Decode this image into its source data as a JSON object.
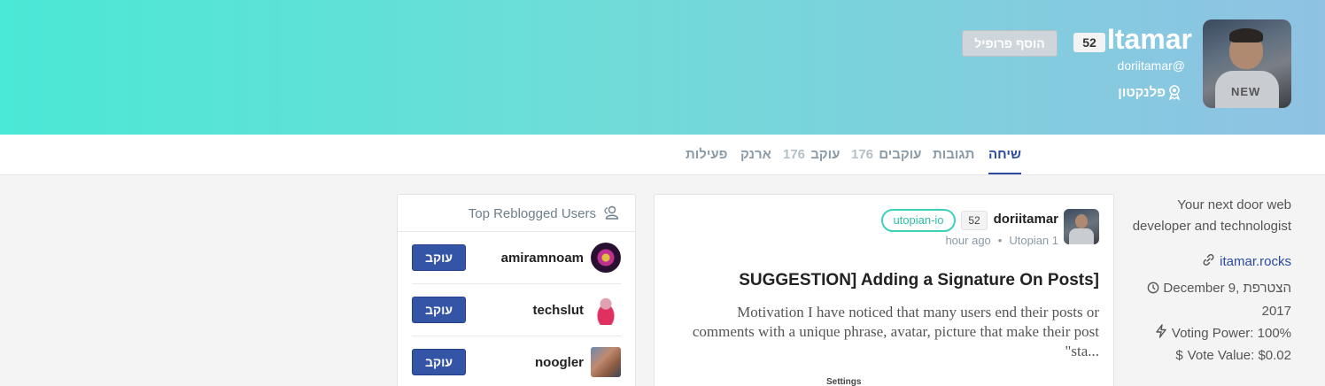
{
  "profile": {
    "name": "Itamar",
    "reputation": "52",
    "handle": "doriitamar@",
    "rank": "פלנקטון",
    "add_profile_label": "הוסף פרופיל"
  },
  "tabs": {
    "blog": "שיחה",
    "comments": "תגובות",
    "followers_label": "עוקבים",
    "followers_count": "176",
    "following_label": "עוקב",
    "following_count": "176",
    "wallet": "ארנק",
    "activity": "פעילות"
  },
  "sidebar": {
    "bio": "Your next door web developer and technologist",
    "website": "itamar.rocks",
    "joined": "December 9, הצטרפת 2017",
    "voting_power": "Voting Power: 100%",
    "vote_value": "Vote Value: $0.02"
  },
  "post": {
    "author": "doriitamar",
    "reputation": "52",
    "tag": "utopian-io",
    "time": "hour ago",
    "community": "Utopian 1",
    "title": "SUGGESTION] Adding a Signature On Posts]",
    "excerpt": "Motivation I have noticed that many users end their posts or comments with a unique phrase, avatar, picture that make their post \"sta...",
    "image_caption": "Settings"
  },
  "top_reblogged": {
    "title": "Top Reblogged Users",
    "follow_label": "עוקב",
    "users": [
      {
        "name": "amiramnoam"
      },
      {
        "name": "techslut"
      },
      {
        "name": "noogler"
      }
    ]
  },
  "colors": {
    "accent": "#2b4aa0",
    "banner_start": "#4ae8d6",
    "banner_end": "#8fc2e3",
    "tag": "#3cd1b8"
  }
}
